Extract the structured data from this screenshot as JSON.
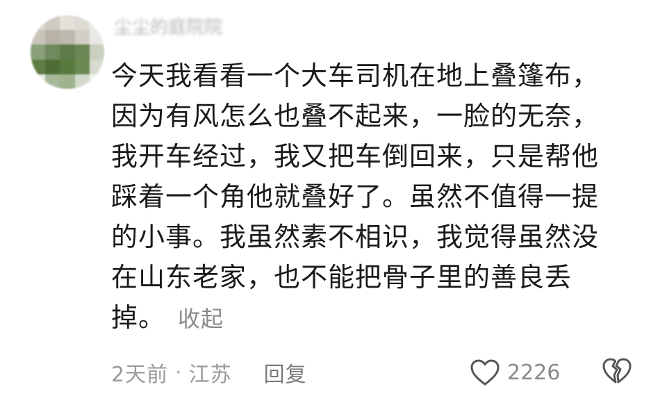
{
  "comment": {
    "username": "尘尘的庭院院",
    "lines": [
      "今天我看看一个大车司机在地上叠篷布，",
      "因为有风怎么也叠不起来，一脸的无奈，",
      "我开车经过，我又把车倒回来，只是帮他",
      "踩着一个角他就叠好了。虽然不值得一提",
      "的小事。我虽然素不相识，我觉得虽然没",
      "在山东老家，也不能把骨子里的善良丢",
      "掉。"
    ],
    "collapse_label": "收起",
    "time": "2天前",
    "separator": "·",
    "location": "江苏",
    "reply_label": "回复",
    "like_count": "2226",
    "like_icon": "heart-outline-icon",
    "dislike_icon": "broken-heart-icon"
  },
  "colors": {
    "text": "#1a1a1a",
    "meta": "#9a9a9a",
    "icon": "#555555"
  }
}
